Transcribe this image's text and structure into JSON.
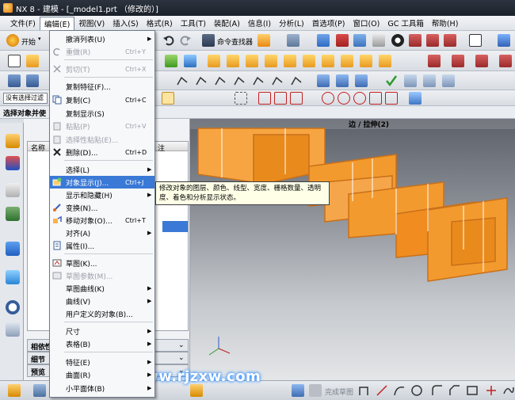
{
  "window": {
    "title": "NX 8 - 建模 - [_model1.prt （修改的）]"
  },
  "menubar": {
    "items": [
      {
        "label": "文件(F)"
      },
      {
        "label": "编辑(E)"
      },
      {
        "label": "视图(V)"
      },
      {
        "label": "插入(S)"
      },
      {
        "label": "格式(R)"
      },
      {
        "label": "工具(T)"
      },
      {
        "label": "装配(A)"
      },
      {
        "label": "信息(I)"
      },
      {
        "label": "分析(L)"
      },
      {
        "label": "首选项(P)"
      },
      {
        "label": "窗口(O)"
      },
      {
        "label": "GC 工具箱"
      },
      {
        "label": "帮助(H)"
      }
    ]
  },
  "toolbar": {
    "start_label": "开始",
    "command_finder_label": "命令查找器",
    "selection_filter": "没有选择过滤",
    "select_prompt": "选择对象并使"
  },
  "edit_menu": {
    "items": [
      {
        "label": "撤消列表(U)",
        "shortcut": "",
        "submenu": true,
        "disabled": false,
        "icon": "none"
      },
      {
        "label": "重做(R)",
        "shortcut": "Ctrl+Y",
        "submenu": false,
        "disabled": true,
        "icon": "redo-icon"
      },
      {
        "label": "剪切(T)",
        "shortcut": "Ctrl+X",
        "submenu": false,
        "disabled": true,
        "icon": "cut-icon"
      },
      {
        "label": "复制特征(F)...",
        "shortcut": "",
        "submenu": false,
        "disabled": false,
        "icon": "none"
      },
      {
        "label": "复制(C)",
        "shortcut": "Ctrl+C",
        "submenu": false,
        "disabled": false,
        "icon": "copy-icon"
      },
      {
        "label": "复制显示(S)",
        "shortcut": "",
        "submenu": false,
        "disabled": false,
        "icon": "none"
      },
      {
        "label": "粘贴(P)",
        "shortcut": "Ctrl+V",
        "submenu": false,
        "disabled": true,
        "icon": "paste-icon"
      },
      {
        "label": "选择性粘贴(E)...",
        "shortcut": "",
        "submenu": false,
        "disabled": true,
        "icon": "paste-special-icon"
      },
      {
        "label": "删除(D)...",
        "shortcut": "Ctrl+D",
        "submenu": false,
        "disabled": false,
        "icon": "delete-icon"
      },
      {
        "label": "选择(L)",
        "shortcut": "",
        "submenu": true,
        "disabled": false,
        "icon": "none"
      },
      {
        "label": "对象显示(J)...",
        "shortcut": "Ctrl+J",
        "submenu": false,
        "disabled": false,
        "icon": "object-display-icon",
        "highlighted": true
      },
      {
        "label": "显示和隐藏(H)",
        "shortcut": "",
        "submenu": true,
        "disabled": false,
        "icon": "none"
      },
      {
        "label": "变换(N)...",
        "shortcut": "",
        "submenu": false,
        "disabled": false,
        "icon": "transform-icon"
      },
      {
        "label": "移动对象(O)...",
        "shortcut": "Ctrl+T",
        "submenu": false,
        "disabled": false,
        "icon": "move-object-icon"
      },
      {
        "label": "对齐(A)",
        "shortcut": "",
        "submenu": true,
        "disabled": false,
        "icon": "none"
      },
      {
        "label": "属性(I)...",
        "shortcut": "",
        "submenu": false,
        "disabled": false,
        "icon": "properties-icon"
      },
      {
        "label": "草图(K)...",
        "shortcut": "",
        "submenu": false,
        "disabled": false,
        "icon": "sketch-icon"
      },
      {
        "label": "草图参数(M)...",
        "shortcut": "",
        "submenu": false,
        "disabled": true,
        "icon": "sketch-params-icon"
      },
      {
        "label": "草图曲线(K)",
        "shortcut": "",
        "submenu": true,
        "disabled": false,
        "icon": "none"
      },
      {
        "label": "曲线(V)",
        "shortcut": "",
        "submenu": true,
        "disabled": false,
        "icon": "none"
      },
      {
        "label": "用户定义的对象(B)...",
        "shortcut": "",
        "submenu": false,
        "disabled": false,
        "icon": "none"
      },
      {
        "label": "尺寸",
        "shortcut": "",
        "submenu": true,
        "disabled": false,
        "icon": "none"
      },
      {
        "label": "表格(B)",
        "shortcut": "",
        "submenu": true,
        "disabled": false,
        "icon": "none"
      },
      {
        "label": "特征(E)",
        "shortcut": "",
        "submenu": true,
        "disabled": false,
        "icon": "none"
      },
      {
        "label": "曲面(R)",
        "shortcut": "",
        "submenu": true,
        "disabled": false,
        "icon": "none"
      },
      {
        "label": "小平面体(B)",
        "shortcut": "",
        "submenu": true,
        "disabled": false,
        "icon": "none"
      }
    ]
  },
  "tooltip": {
    "line1": "修改对象的图层、颜色、线型、宽度、栅格数量、透明",
    "line2": "度、着色和分析显示状态。"
  },
  "part_navigator": {
    "column_name": "名称",
    "column_update": "注",
    "panels": [
      {
        "label": "相依性"
      },
      {
        "label": "细节"
      },
      {
        "label": "预览"
      }
    ]
  },
  "graphics": {
    "view_title": "边 / 拉伸(2)"
  },
  "statusbar": {
    "sketch_button": "完成草图"
  },
  "watermark": "www.rjzxw.com",
  "colors": {
    "model_orange": "#f39a2e",
    "highlight": "#3a79d6",
    "tooltip_bg": "#ffffe8"
  }
}
